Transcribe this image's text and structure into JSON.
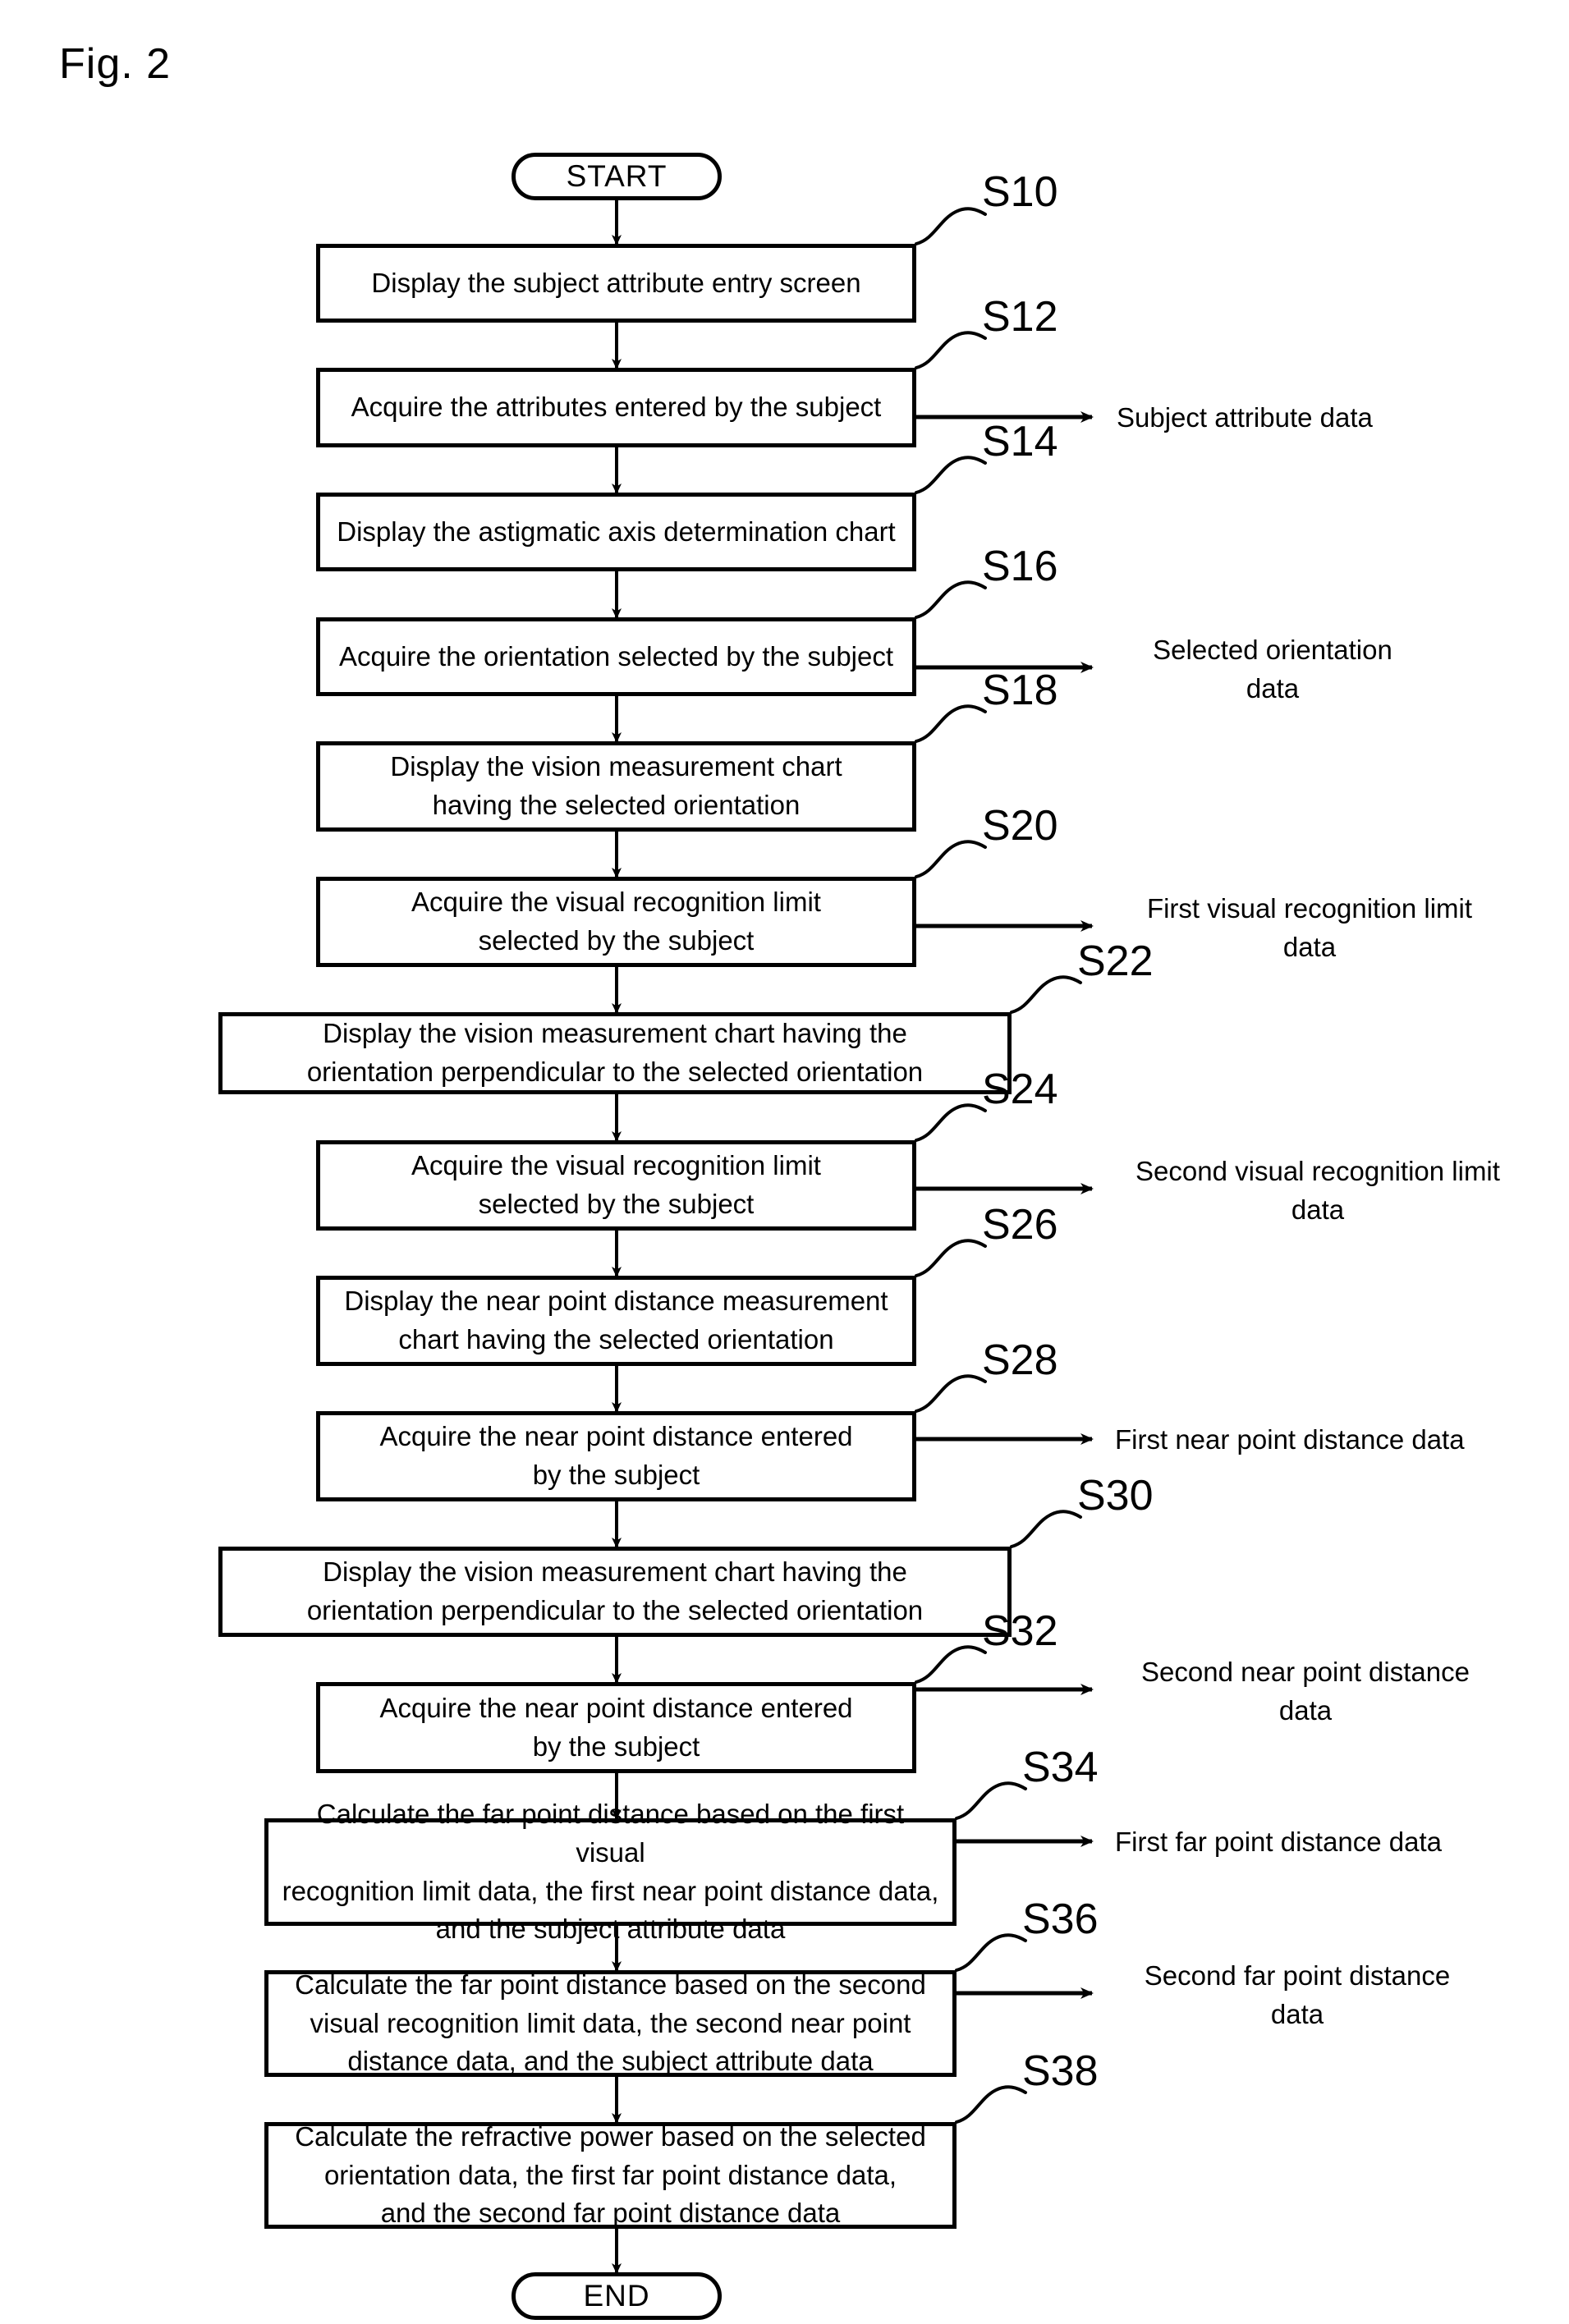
{
  "figure": {
    "caption": "Fig. 2"
  },
  "terminators": {
    "start": "START",
    "end": "END"
  },
  "steps": [
    {
      "id": "S10",
      "num": "S10",
      "text": "Display the subject attribute entry screen"
    },
    {
      "id": "S12",
      "num": "S12",
      "text": "Acquire the attributes entered by the subject"
    },
    {
      "id": "S14",
      "num": "S14",
      "text": "Display the astigmatic axis determination chart"
    },
    {
      "id": "S16",
      "num": "S16",
      "text": "Acquire the orientation selected by the subject"
    },
    {
      "id": "S18",
      "num": "S18",
      "text": "Display the vision measurement chart\nhaving the selected orientation"
    },
    {
      "id": "S20",
      "num": "S20",
      "text": "Acquire the visual recognition limit\nselected by the subject"
    },
    {
      "id": "S22",
      "num": "S22",
      "text": "Display the vision measurement chart having the\norientation perpendicular to the selected orientation"
    },
    {
      "id": "S24",
      "num": "S24",
      "text": "Acquire the visual recognition limit\nselected by the subject"
    },
    {
      "id": "S26",
      "num": "S26",
      "text": "Display the near point distance measurement\nchart having the selected orientation"
    },
    {
      "id": "S28",
      "num": "S28",
      "text": "Acquire the near point distance entered\nby the subject"
    },
    {
      "id": "S30",
      "num": "S30",
      "text": "Display the vision measurement chart having the\norientation perpendicular to the selected orientation"
    },
    {
      "id": "S32",
      "num": "S32",
      "text": "Acquire the near point distance entered\nby the subject"
    },
    {
      "id": "S34",
      "num": "S34",
      "text": "Calculate the far point distance based on the first visual\nrecognition limit data, the first near point distance data,\nand the subject attribute data"
    },
    {
      "id": "S36",
      "num": "S36",
      "text": "Calculate the far point distance based on the second\nvisual recognition limit data, the second near point\ndistance data, and the subject attribute data"
    },
    {
      "id": "S38",
      "num": "S38",
      "text": "Calculate the refractive power based on the selected\norientation data, the first far point distance data,\nand the second far point distance data"
    }
  ],
  "data_outputs": [
    {
      "from": "S12",
      "text": "Subject attribute data"
    },
    {
      "from": "S16",
      "text": "Selected orientation\ndata"
    },
    {
      "from": "S20",
      "text": "First visual recognition limit\ndata"
    },
    {
      "from": "S24",
      "text": "Second visual recognition limit\ndata"
    },
    {
      "from": "S28",
      "text": "First near point distance data"
    },
    {
      "from": "S32",
      "text": "Second near point distance\ndata"
    },
    {
      "from": "S34",
      "text": "First far point distance data"
    },
    {
      "from": "S36",
      "text": "Second far point distance\ndata"
    }
  ],
  "colors": {
    "ink": "#000000",
    "paper": "#ffffff"
  }
}
